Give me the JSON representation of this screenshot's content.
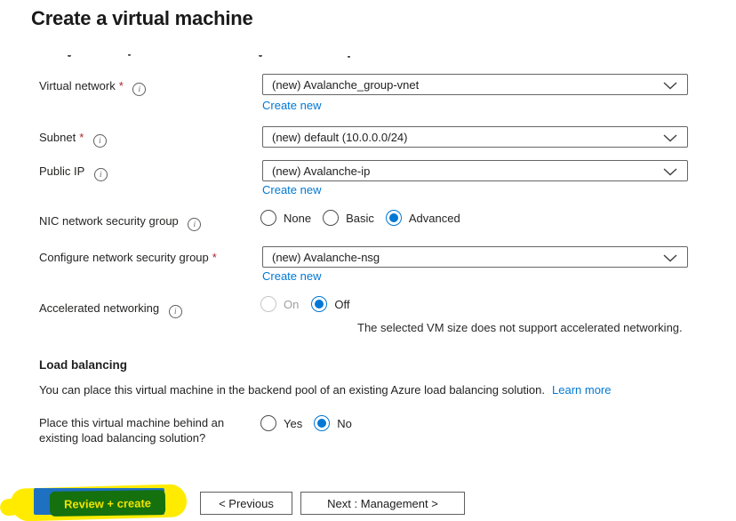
{
  "title": "Create a virtual machine",
  "ui": {
    "required_marker": "*",
    "info_glyph": "i"
  },
  "fields": {
    "virtual_network": {
      "label": "Virtual network",
      "required": true,
      "value": "(new) Avalanche_group-vnet",
      "create_new": "Create new"
    },
    "subnet": {
      "label": "Subnet",
      "required": true,
      "value": "(new) default (10.0.0.0/24)"
    },
    "public_ip": {
      "label": "Public IP",
      "required": false,
      "value": "(new) Avalanche-ip",
      "create_new": "Create new"
    },
    "nic_nsg": {
      "label": "NIC network security group",
      "options": [
        "None",
        "Basic",
        "Advanced"
      ],
      "selected": "Advanced"
    },
    "configure_nsg": {
      "label": "Configure network security group",
      "required": true,
      "value": "(new) Avalanche-nsg",
      "create_new": "Create new"
    },
    "accelerated_networking": {
      "label": "Accelerated networking",
      "options": [
        "On",
        "Off"
      ],
      "selected": "Off",
      "disabled_option": "On",
      "note": "The selected VM size does not support accelerated networking."
    }
  },
  "load_balancing": {
    "heading": "Load balancing",
    "description": "You can place this virtual machine in the backend pool of an existing Azure load balancing solution.",
    "learn_more": "Learn more",
    "question": "Place this virtual machine behind an existing load balancing solution?",
    "options": [
      "Yes",
      "No"
    ],
    "selected": "No"
  },
  "footer": {
    "review_create": "Review + create",
    "previous": "< Previous",
    "next": "Next : Management >"
  },
  "colors": {
    "accent": "#0078d4",
    "link": "#0078d4",
    "required": "#a4262c",
    "text": "#252423",
    "muted": "#a19f9d",
    "border_input": "#666666",
    "border_button": "#5f5f5f",
    "disabled_radio": "#c8c6c4",
    "highlight_yellow": "#ffeb00",
    "highlight_green": "#15700e",
    "button_blue": "#1e70c1"
  }
}
